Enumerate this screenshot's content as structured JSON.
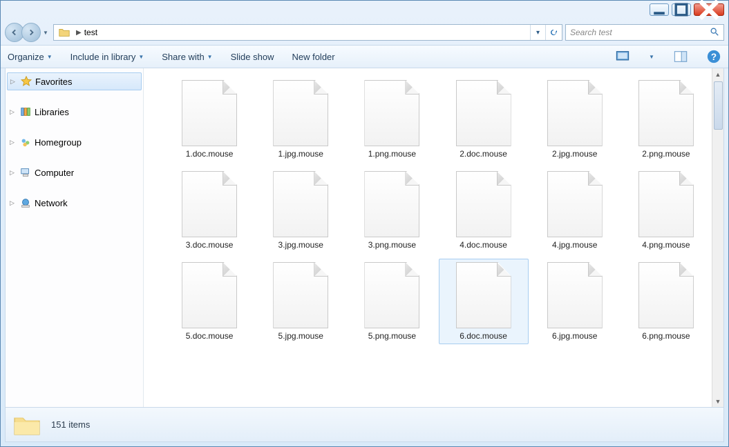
{
  "breadcrumb": {
    "folder": "test"
  },
  "search": {
    "placeholder": "Search test"
  },
  "toolbar": {
    "organize": "Organize",
    "include": "Include in library",
    "share": "Share with",
    "slideshow": "Slide show",
    "newfolder": "New folder"
  },
  "sidebar": {
    "favorites": "Favorites",
    "libraries": "Libraries",
    "homegroup": "Homegroup",
    "computer": "Computer",
    "network": "Network"
  },
  "files": [
    {
      "name": "1.doc.mouse",
      "selected": false
    },
    {
      "name": "1.jpg.mouse",
      "selected": false
    },
    {
      "name": "1.png.mouse",
      "selected": false
    },
    {
      "name": "2.doc.mouse",
      "selected": false
    },
    {
      "name": "2.jpg.mouse",
      "selected": false
    },
    {
      "name": "2.png.mouse",
      "selected": false
    },
    {
      "name": "3.doc.mouse",
      "selected": false
    },
    {
      "name": "3.jpg.mouse",
      "selected": false
    },
    {
      "name": "3.png.mouse",
      "selected": false
    },
    {
      "name": "4.doc.mouse",
      "selected": false
    },
    {
      "name": "4.jpg.mouse",
      "selected": false
    },
    {
      "name": "4.png.mouse",
      "selected": false
    },
    {
      "name": "5.doc.mouse",
      "selected": false
    },
    {
      "name": "5.jpg.mouse",
      "selected": false
    },
    {
      "name": "5.png.mouse",
      "selected": false
    },
    {
      "name": "6.doc.mouse",
      "selected": true
    },
    {
      "name": "6.jpg.mouse",
      "selected": false
    },
    {
      "name": "6.png.mouse",
      "selected": false
    }
  ],
  "status": {
    "count": "151 items"
  }
}
